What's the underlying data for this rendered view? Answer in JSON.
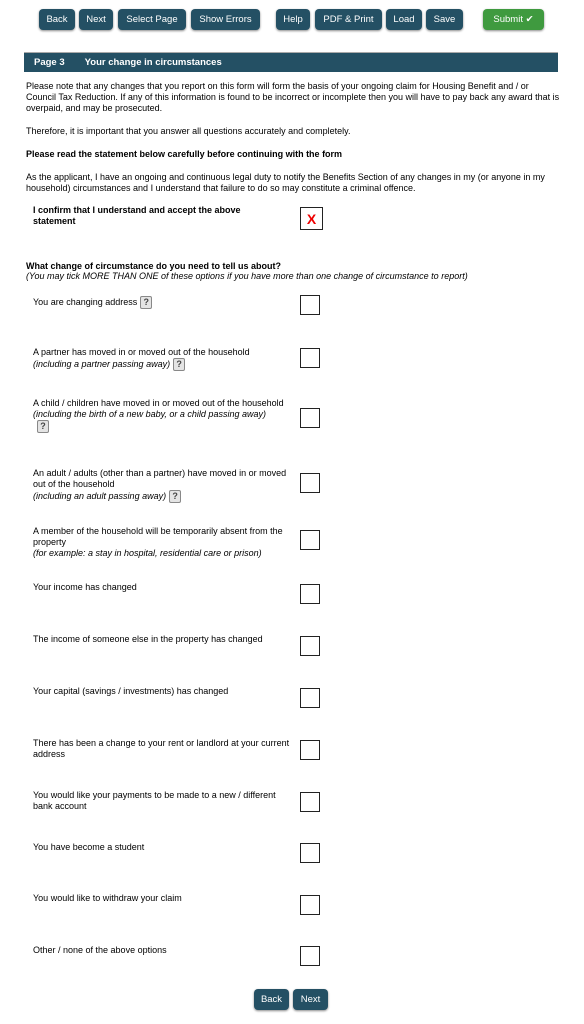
{
  "toolbar": {
    "back": "Back",
    "next": "Next",
    "select_page": "Select Page",
    "show_errors": "Show Errors",
    "help": "Help",
    "pdf_print": "PDF & Print",
    "load": "Load",
    "save": "Save",
    "submit": "Submit ✔"
  },
  "header": {
    "page": "Page 3",
    "title": "Your change in circumstances"
  },
  "intro": {
    "p1": "Please note that any changes that you report on this form will form the basis of your ongoing claim for Housing Benefit and / or Council Tax Reduction. If any of this information is found to be incorrect or incomplete then you will have to pay back any award that is overpaid, and may be prosecuted.",
    "p2": "Therefore, it is important that you answer all questions accurately and completely.",
    "p3": "Please read the statement below carefully before continuing with the form",
    "p4": "As the applicant, I have an ongoing and continuous legal duty to notify the Benefits Section of any changes in my (or anyone in my household) circumstances and I understand that failure to do so may constitute a criminal offence."
  },
  "confirm": {
    "label": "I confirm that I understand and accept the above statement",
    "value": "X"
  },
  "question": {
    "title": "What change of circumstance do you need to tell us about?",
    "hint": "(You may tick MORE THAN ONE of these options if you have more than one change of circumstance to report)"
  },
  "help_icon": "?",
  "options": [
    {
      "label": "You are changing address",
      "note": ""
    },
    {
      "label": "A partner has moved in or moved out of the household",
      "note": "(including a partner passing away)"
    },
    {
      "label": "A child / children have moved in or moved out of the household",
      "note": "(including the birth of a new baby, or a child passing away)"
    },
    {
      "label": "An adult / adults (other than a partner) have moved in or moved out of the household",
      "note": "(including an adult passing away)"
    },
    {
      "label": "A member of the household will be temporarily absent from the property",
      "note": "(for example: a stay in hospital, residential care or prison)"
    },
    {
      "label": "Your income has changed",
      "note": ""
    },
    {
      "label": "The income of someone else in the property has changed",
      "note": ""
    },
    {
      "label": "Your capital (savings / investments) has changed",
      "note": ""
    },
    {
      "label": "There has been a change to your rent or landlord at your current address",
      "note": ""
    },
    {
      "label": "You would like your payments to be made to a new / different bank account",
      "note": ""
    },
    {
      "label": "You have become a student",
      "note": ""
    },
    {
      "label": "You would like to withdraw your claim",
      "note": ""
    },
    {
      "label": "Other / none of the above options",
      "note": ""
    }
  ],
  "footer": {
    "back": "Back",
    "next": "Next"
  }
}
